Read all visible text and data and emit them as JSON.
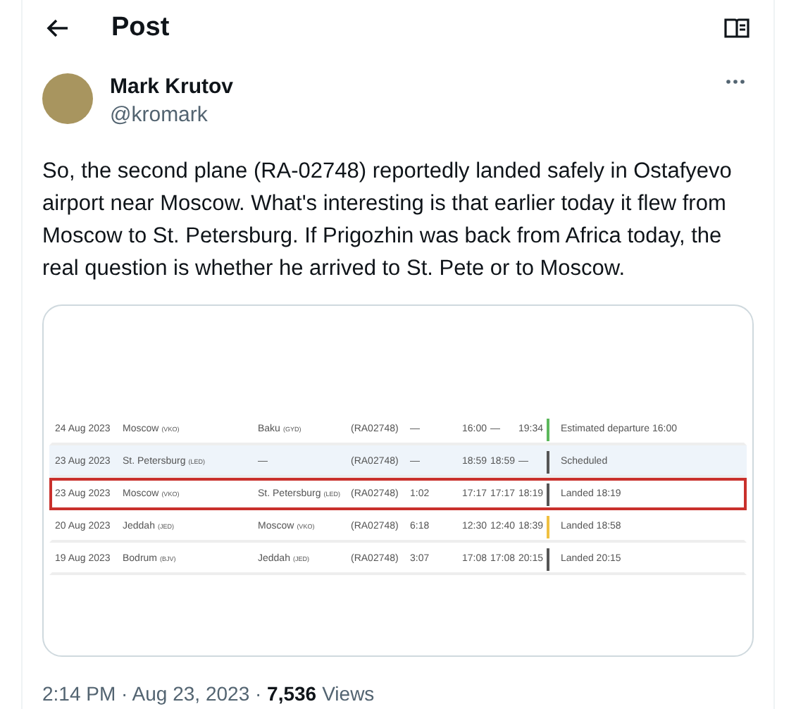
{
  "header": {
    "title": "Post"
  },
  "author": {
    "name": "Mark Krutov",
    "handle": "@kromark"
  },
  "text": "So, the second plane (RA-02748) reportedly landed safely in Ostafyevo airport near Moscow. What's interesting is that earlier today it flew from Moscow to St. Petersburg. If Prigozhin was back from Africa today, the real question is whether he arrived to St. Pete or to Moscow.",
  "flights": [
    {
      "date": "24 Aug 2023",
      "from": "Moscow",
      "from_code": "(VKO)",
      "to": "Baku",
      "to_code": "(GYD)",
      "flight": "(RA02748)",
      "duration": "—",
      "std": "16:00",
      "atd": "—",
      "sta": "19:34",
      "color": "#5cb85c",
      "status": "Estimated departure 16:00",
      "shaded": false,
      "highlighted": false
    },
    {
      "date": "23 Aug 2023",
      "from": "St. Petersburg",
      "from_code": "(LED)",
      "to": "—",
      "flight": "(RA02748)",
      "duration": "—",
      "std": "18:59",
      "atd": "18:59",
      "sta": "—",
      "color": "#555555",
      "status": "Scheduled",
      "shaded": true,
      "highlighted": false
    },
    {
      "date": "23 Aug 2023",
      "from": "Moscow",
      "from_code": "(VKO)",
      "to": "St. Petersburg",
      "to_code": "(LED)",
      "flight": "(RA02748)",
      "duration": "1:02",
      "std": "17:17",
      "atd": "17:17",
      "sta": "18:19",
      "color": "#555555",
      "status": "Landed 18:19",
      "shaded": false,
      "highlighted": true
    },
    {
      "date": "20 Aug 2023",
      "from": "Jeddah",
      "from_code": "(JED)",
      "to": "Moscow",
      "to_code": "(VKO)",
      "flight": "(RA02748)",
      "duration": "6:18",
      "std": "12:30",
      "atd": "12:40",
      "sta": "18:39",
      "color": "#f0c040",
      "status": "Landed 18:58",
      "shaded": false,
      "highlighted": false
    },
    {
      "date": "19 Aug 2023",
      "from": "Bodrum",
      "from_code": "(BJV)",
      "to": "Jeddah",
      "to_code": "(JED)",
      "flight": "(RA02748)",
      "duration": "3:07",
      "std": "17:08",
      "atd": "17:08",
      "sta": "20:15",
      "color": "#555555",
      "status": "Landed 20:15",
      "shaded": false,
      "highlighted": false
    }
  ],
  "footer": {
    "time": "2:14 PM · Aug 23, 2023 · ",
    "views_count": "7,536",
    "views_label": "Views"
  }
}
